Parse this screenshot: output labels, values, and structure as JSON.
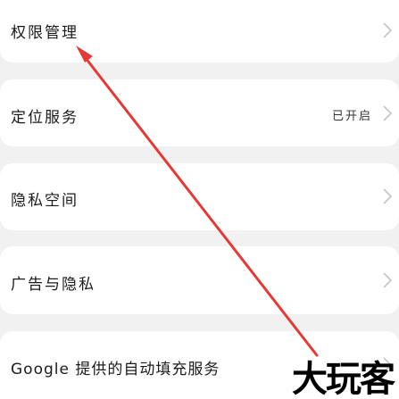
{
  "settings": {
    "items": [
      {
        "label": "权限管理",
        "status": ""
      },
      {
        "label": "定位服务",
        "status": "已开启"
      },
      {
        "label": "隐私空间",
        "status": ""
      },
      {
        "label": "广告与隐私",
        "status": ""
      },
      {
        "label": "Google 提供的自动填充服务",
        "status": ""
      }
    ]
  },
  "watermark": {
    "text": "大玩客"
  },
  "annotation": {
    "arrow_color": "#e53935"
  },
  "icons": {
    "chevron": "chevron-right-icon"
  }
}
